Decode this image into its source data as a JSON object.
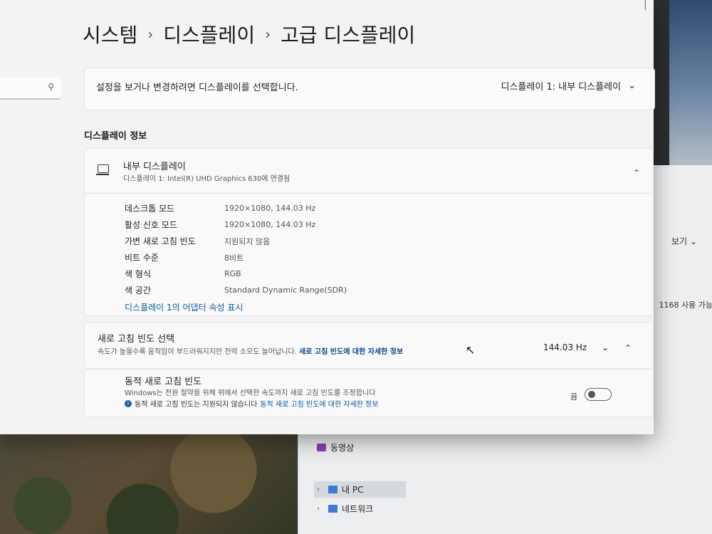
{
  "breadcrumb": {
    "items": [
      "시스템",
      "디스플레이",
      "고급 디스플레이"
    ],
    "separator": "›"
  },
  "search": {
    "icon": "search-icon"
  },
  "display_select": {
    "label": "설정을 보거나 변경하려면 디스플레이를 선택합니다.",
    "selected": "디스플레이 1: 내부 디스플레이"
  },
  "display_info": {
    "section_title": "디스플레이 정보",
    "title": "내부 디스플레이",
    "subtitle": "디스플레이 1: Intel(R) UHD Graphics 630에 연결됨",
    "rows": [
      {
        "key": "데스크톱 모드",
        "value": "1920×1080, 144.03 Hz"
      },
      {
        "key": "활성 신호 모드",
        "value": "1920×1080, 144.03 Hz"
      },
      {
        "key": "가변 새로 고침 빈도",
        "value": "지원되지 않음"
      },
      {
        "key": "비트 수준",
        "value": "8비트"
      },
      {
        "key": "색 형식",
        "value": "RGB"
      },
      {
        "key": "색 공간",
        "value": "Standard Dynamic Range(SDR)"
      }
    ],
    "adapter_link": "디스플레이 1의 어댑터 속성 표시"
  },
  "refresh_rate": {
    "title": "새로 고침 빈도 선택",
    "description": "속도가 높을수록 움직임이 부드러워지지만 전력 소모도 늘어납니다.",
    "link": "새로 고침 빈도에 대한 자세한 정보",
    "value": "144.03 Hz"
  },
  "dynamic_refresh": {
    "title": "동적 새로 고침 빈도",
    "description": "Windows는 전원 절약을 위해 위에서 선택한 속도까지 새로 고침 빈도를 조정합니다",
    "note": "동적 새로 고침 빈도는 지원되지 않습니다",
    "note_link": "동적 새로 고침 빈도에 대한 자세한 정보",
    "toggle_label": "끔",
    "toggle_state": "off"
  },
  "explorer": {
    "view_label": "보기",
    "usage_text": "1168 사용 가능",
    "nav": [
      {
        "label": "동영상",
        "icon": "video-folder-icon",
        "color": "#8a3fb3"
      },
      {
        "label": "내 PC",
        "icon": "pc-icon",
        "color": "#3a7bd5"
      },
      {
        "label": "네트워크",
        "icon": "network-icon",
        "color": "#3a7bd5"
      }
    ]
  }
}
